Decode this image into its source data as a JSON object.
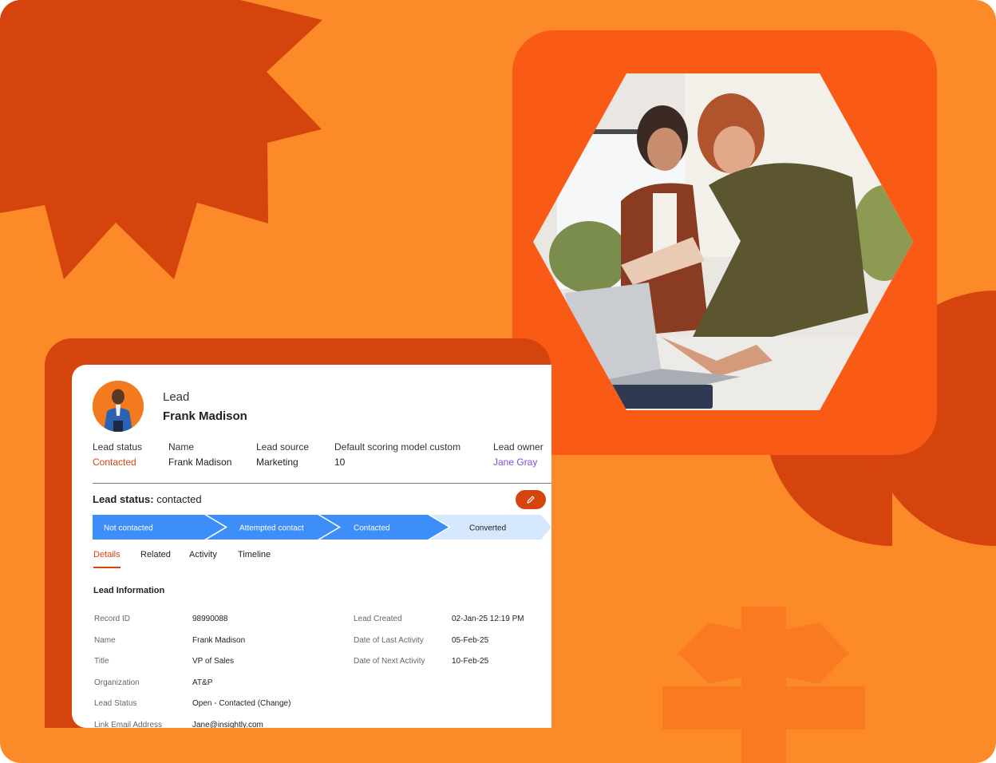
{
  "lead_header": {
    "record_type": "Lead",
    "full_name": "Frank Madison"
  },
  "summary_fields": [
    {
      "label": "Lead status",
      "value": "Contacted",
      "value_color": "#d6440d"
    },
    {
      "label": "Name",
      "value": "Frank Madison",
      "value_color": "#222222"
    },
    {
      "label": "Lead source",
      "value": "Marketing",
      "value_color": "#222222"
    },
    {
      "label": "Default scoring model custom",
      "value": "10",
      "value_color": "#222222"
    },
    {
      "label": "Lead owner",
      "value": "Jane Gray",
      "value_color": "#7a4fe0"
    }
  ],
  "status_bar": {
    "label": "Lead status:",
    "value": "contacted",
    "edit_icon": "pencil-icon"
  },
  "pipeline_stages": [
    {
      "label": "Not contacted",
      "state": "done"
    },
    {
      "label": "Attempted contact",
      "state": "done"
    },
    {
      "label": "Contacted",
      "state": "current"
    },
    {
      "label": "Converted",
      "state": "upcoming"
    }
  ],
  "tabs": [
    {
      "label": "Details",
      "active": true
    },
    {
      "label": "Related",
      "active": false
    },
    {
      "label": "Activity",
      "active": false
    },
    {
      "label": "Timeline",
      "active": false
    }
  ],
  "lead_information": {
    "title": "Lead Information",
    "left_fields": [
      {
        "label": "Record ID",
        "value": "98990088"
      },
      {
        "label": "Name",
        "value": "Frank Madison"
      },
      {
        "label": "Title",
        "value": "VP of Sales"
      },
      {
        "label": "Organization",
        "value": "AT&P"
      },
      {
        "label": "Lead Status",
        "value": "Open - Contacted (Change)"
      },
      {
        "label": "Link Email Address",
        "value": "Jane@insightly.com"
      }
    ],
    "right_fields": [
      {
        "label": "Lead Created",
        "value": "02-Jan-25 12:19 PM"
      },
      {
        "label": "Date of Last Activity",
        "value": "05-Feb-25"
      },
      {
        "label": "Date of Next Activity",
        "value": "10-Feb-25"
      }
    ]
  },
  "colors": {
    "background": "#fd8a28",
    "accent_dark": "#d6440d",
    "accent_bright": "#f95a16",
    "stage_done": "#3d8ef8",
    "stage_upcoming": "#d6e8fd",
    "owner_link": "#7a4fe0"
  }
}
